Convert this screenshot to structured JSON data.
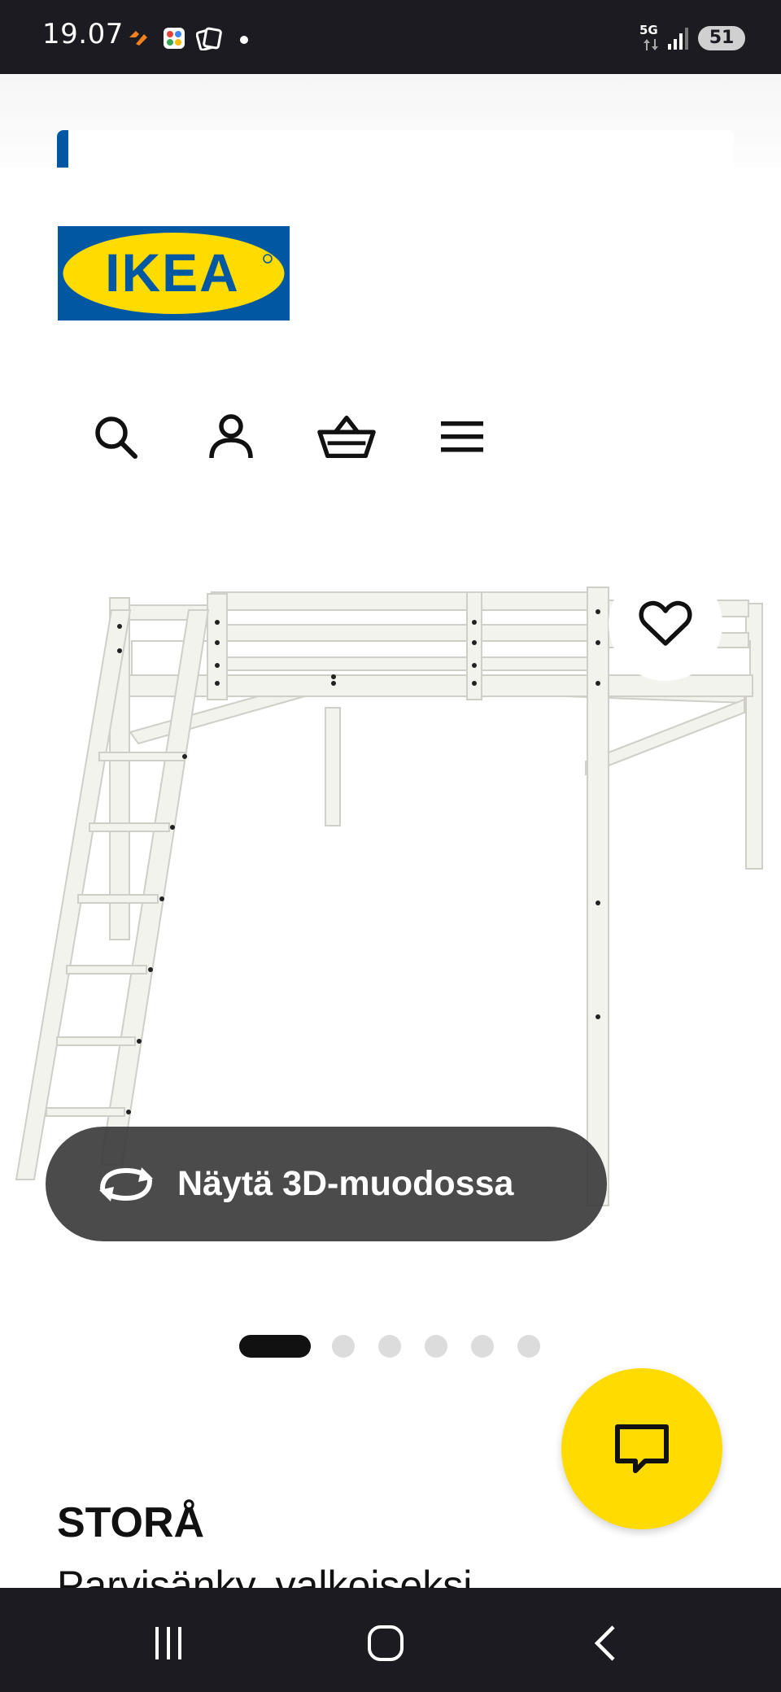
{
  "status_bar": {
    "time": "19.07",
    "network": "5G",
    "battery": "51"
  },
  "header": {
    "logo_text": "IKEA"
  },
  "product": {
    "view_3d_label": "Näytä 3D-muodossa",
    "name": "STORÅ",
    "description": "Parvisänky, valkoiseksi"
  },
  "image_pager": {
    "count": 6,
    "active_index": 0
  },
  "colors": {
    "ikea_blue": "#0058a3",
    "ikea_yellow": "#ffdb00",
    "status_bar": "#1c1b21"
  },
  "icons": [
    "search-icon",
    "account-icon",
    "basket-icon",
    "menu-icon",
    "heart-icon",
    "rotate-3d-icon",
    "chat-icon"
  ]
}
